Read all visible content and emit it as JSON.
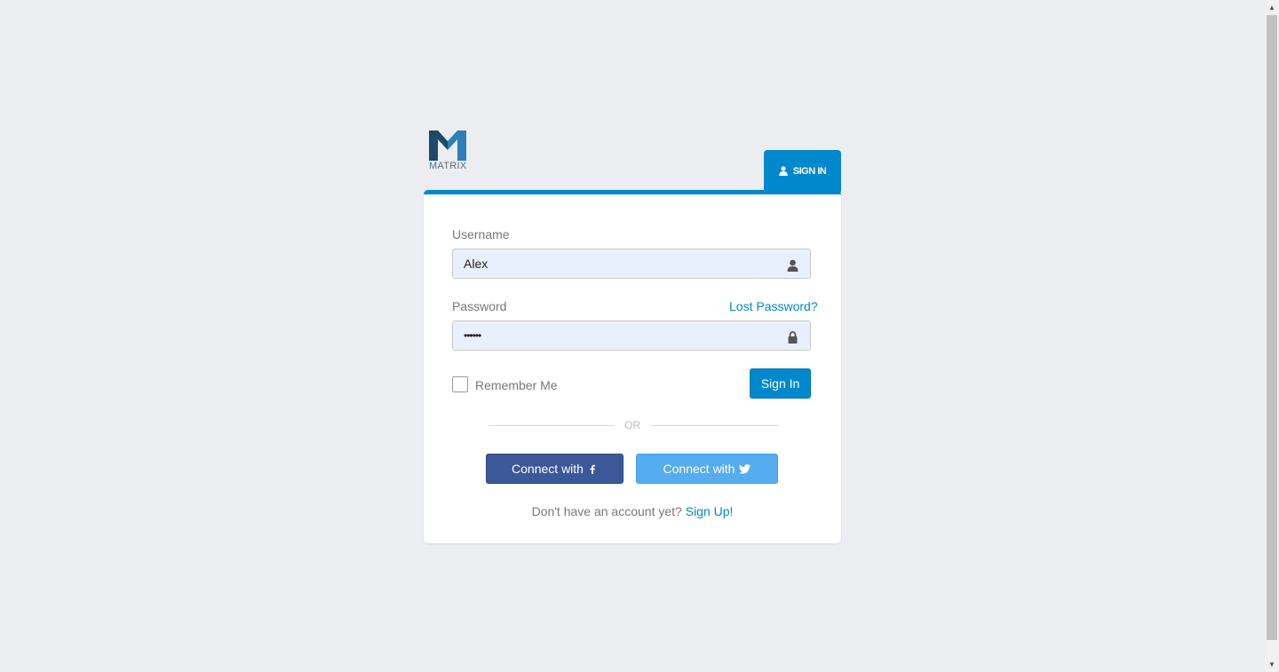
{
  "brand": {
    "logo_text": "MATRIX",
    "colors": {
      "primary": "#0088cc",
      "logo_dark": "#1b4a6b",
      "logo_light": "#2c7fb8"
    }
  },
  "tab": {
    "icon": "user-icon",
    "label": "SIGN IN"
  },
  "form": {
    "username": {
      "label": "Username",
      "value": "Alex",
      "icon": "user-icon"
    },
    "password": {
      "label": "Password",
      "value": "••••••",
      "icon": "lock-icon",
      "lost_link": "Lost Password?"
    },
    "remember_label": "Remember Me",
    "submit_label": "Sign In"
  },
  "divider": {
    "text": "OR"
  },
  "social": {
    "facebook": {
      "label": "Connect with",
      "icon": "facebook-icon",
      "color": "#3b5998"
    },
    "twitter": {
      "label": "Connect with",
      "icon": "twitter-icon",
      "color": "#55acee"
    }
  },
  "footer": {
    "text": "Don't have an account yet?",
    "link": "Sign Up!"
  }
}
